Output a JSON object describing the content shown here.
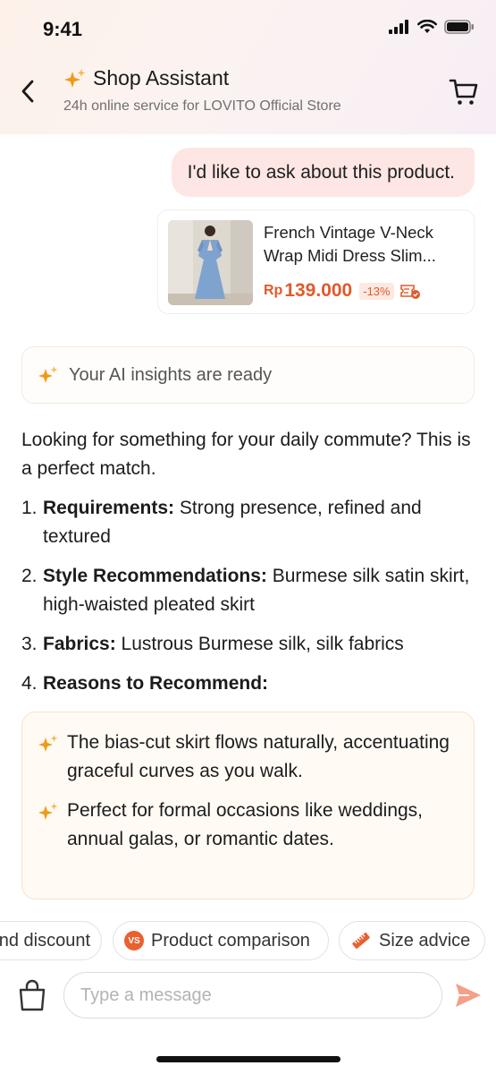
{
  "status_bar": {
    "time": "9:41"
  },
  "header": {
    "title": "Shop Assistant",
    "subtitle": "24h online service for LOVITO Official Store"
  },
  "user_message": {
    "text": "I'd like to ask about this product."
  },
  "product": {
    "name": "French Vintage V-Neck Wrap Midi Dress Slim...",
    "currency": "Rp",
    "price": "139.000",
    "discount": "-13%"
  },
  "insights": {
    "text": "Your AI insights are ready"
  },
  "answer": {
    "intro": "Looking for something for your daily commute? This is a perfect match.",
    "items": [
      {
        "num": "1.",
        "label": "Requirements:",
        "text": " Strong presence, refined and textured"
      },
      {
        "num": "2.",
        "label": "Style Recommendations:",
        "text": " Burmese silk satin skirt, high-waisted pleated skirt"
      },
      {
        "num": "3.",
        "label": "Fabrics:",
        "text": " Lustrous Burmese silk, silk fabrics"
      },
      {
        "num": "4.",
        "label": "Reasons to Recommend:",
        "text": ""
      }
    ],
    "reasons": [
      "The bias-cut skirt flows naturally, accentuating graceful curves as you walk.",
      "Perfect for formal occasions like weddings, annual galas, or romantic dates."
    ]
  },
  "chips": {
    "discount": "nd discount",
    "comparison": "Product comparison",
    "comparison_badge": "VS",
    "size": "Size advice"
  },
  "input": {
    "placeholder": "Type a message"
  },
  "colors": {
    "accent": "#e8612f",
    "price": "#e05a2b",
    "bubble": "#fde6e3"
  }
}
